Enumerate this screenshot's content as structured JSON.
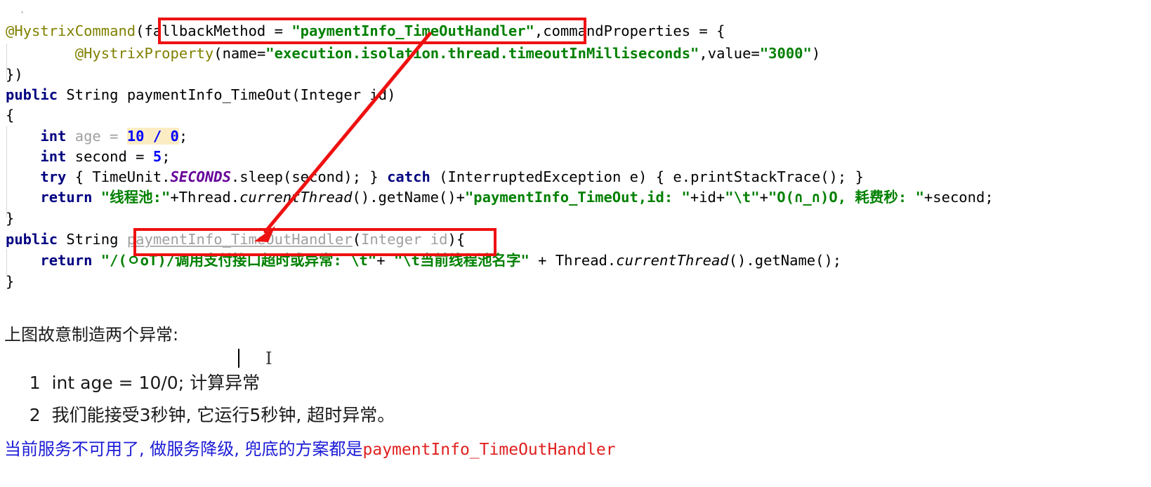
{
  "editor": {
    "lines": [
      {
        "id": "line-annotation-hystrixcommand",
        "text": "@HystrixCommand(fallbackMethod = \"paymentInfo_TimeOutHandler\",commandProperties = {"
      },
      {
        "id": "line-annotation-hystrixproperty",
        "text": "        @HystrixProperty(name=\"execution.isolation.thread.timeoutInMilliseconds\",value=\"3000\")"
      },
      {
        "id": "line-close-annotation",
        "text": "})"
      },
      {
        "id": "line-method-signature",
        "text": "public String paymentInfo_TimeOut(Integer id)"
      },
      {
        "id": "line-open-brace",
        "text": "{"
      },
      {
        "id": "line-int-age",
        "text": "    int age = 10 / 0;"
      },
      {
        "id": "line-int-second",
        "text": "    int second = 5;"
      },
      {
        "id": "line-try-catch",
        "text": "    try { TimeUnit.SECONDS.sleep(second); } catch (InterruptedException e) { e.printStackTrace(); }"
      },
      {
        "id": "line-return-timeout",
        "text": "    return \"线程池:\"+Thread.currentThread().getName()+\"paymentInfo_TimeOut,id: \"+id+\"\\t\"+\"O(∩_∩)O, 耗费秒: \"+second;"
      },
      {
        "id": "line-close-brace-1",
        "text": "}"
      },
      {
        "id": "line-handler-signature",
        "text": "public String paymentInfo_TimeOutHandler(Integer id){"
      },
      {
        "id": "line-return-handler",
        "text": "    return \"/(ㅇoT)/调用支付接口超时或异常: \\t\"+ \"\\t当前线程池名字\" + Thread.currentThread().getName();"
      },
      {
        "id": "line-close-brace-2",
        "text": "}"
      }
    ],
    "tokens": {
      "at_hystrix_command": "@HystrixCommand",
      "fallback_method_kv": "fallbackMethod = ",
      "fallback_method_value": "\"paymentInfo_TimeOutHandler\"",
      "command_properties": ",commandProperties = {",
      "at_hystrix_property": "@HystrixProperty",
      "name_eq": "(name=",
      "timeout_key": "\"execution.isolation.thread.timeoutInMilliseconds\"",
      "value_eq": ",value=",
      "timeout_value": "\"3000\"",
      "paren_close": ")",
      "close_annotation": "})",
      "kw_public": "public",
      "type_string": "String",
      "method_timeout": "paymentInfo_TimeOut(Integer id)",
      "brace_open": "{",
      "kw_int": "int",
      "var_age": "age = ",
      "expr_10_0": "10 / 0",
      "semicolon": ";",
      "var_second": "second = ",
      "num_5": "5",
      "kw_try": "try",
      "try_body": "{ TimeUnit.",
      "seconds_const": "SECONDS",
      "sleep_call": ".sleep(second); }",
      "kw_catch": "catch",
      "catch_body": "(InterruptedException e) { e.printStackTrace(); }",
      "kw_return": "return",
      "str_threadpool": "\"线程池:\"",
      "plus_thread": "+Thread.",
      "current_thread": "currentThread",
      "get_name": "().getName()+",
      "str_payment_id": "\"paymentInfo_TimeOut,id: \"",
      "plus_id": "+id+",
      "str_tab": "\"\\t\"",
      "plus": "+",
      "str_emoji_cost": "\"O(∩_∩)O, 耗费秒: \"",
      "plus_second": "+second;",
      "brace_close": "}",
      "handler_name": "paymentInfo_TimeOutHandler",
      "handler_params_open": "(",
      "handler_params": "Integer id",
      "handler_params_close": ")",
      "handler_brace": "{",
      "str_fallback_msg": "\"/(ㅇoT)/调用支付接口超时或异常: \\t\"",
      "plus_space": "+ ",
      "str_threadname": "\"\\t当前线程池名字\"",
      "plus_space2": " + ",
      "thread_dot": "Thread.",
      "get_name_end": "().getName();"
    },
    "highlight_boxes": [
      {
        "id": "red-box-fallback-method",
        "label": "fallbackMethod = \"paymentInfo_TimeOutHandler\""
      },
      {
        "id": "red-box-handler-method",
        "label": "paymentInfo_TimeOutHandler(Integer id)"
      }
    ],
    "arrow": {
      "id": "red-arrow-fallback-to-handler",
      "from_label": "fallbackMethod value",
      "to_label": "paymentInfo_TimeOutHandler declaration"
    }
  },
  "notes": {
    "heading": "上图故意制造两个异常:",
    "items": [
      {
        "num": "1",
        "text": "int age = 10/0; 计算异常"
      },
      {
        "num": "2",
        "text": "我们能接受3秒钟, 它运行5秒钟, 超时异常。"
      }
    ]
  },
  "conclusion": {
    "text_cn": "当前服务不可用了, 做服务降级, 兜底的方案都是",
    "text_code": "paymentInfo_TimeOutHandler"
  },
  "colors": {
    "keyword": "#000080",
    "string": "#008000",
    "number": "#0000ff",
    "annotation": "#808000",
    "static_field": "#660099",
    "dimmed": "#a0a0a0",
    "highlight_bg": "#fbecc3",
    "annotation_red": "#ee1111",
    "note_blue": "#1b1bd6",
    "note_code_red": "#e02020"
  },
  "cursor": {
    "text_caret": "|",
    "mouse_ibeam": "I"
  }
}
